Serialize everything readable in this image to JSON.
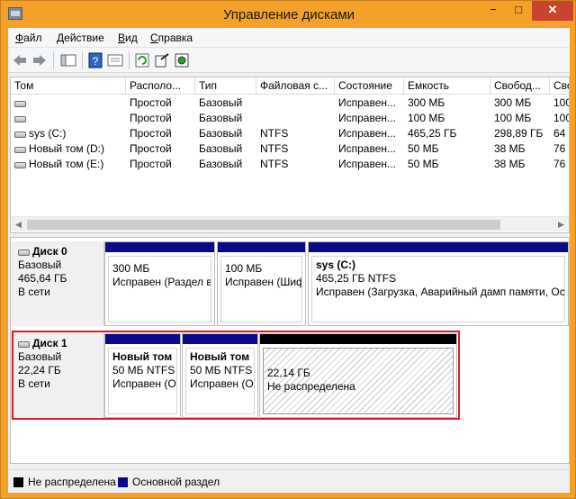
{
  "window": {
    "title": "Управление дисками",
    "min": "−",
    "max": "□",
    "close": "✕"
  },
  "menu": [
    {
      "hot": "Ф",
      "rest": "айл"
    },
    {
      "hot": "Д",
      "rest": "ействие"
    },
    {
      "hot": "В",
      "rest": "ид"
    },
    {
      "hot": "С",
      "rest": "правка"
    }
  ],
  "toolbar": {
    "icons": [
      "back-icon",
      "forward-icon",
      "show-hide-console-icon",
      "help-icon",
      "properties-icon",
      "refresh-icon",
      "export-icon",
      "settings-icon"
    ]
  },
  "list": {
    "columns": [
      "Том",
      "Располо...",
      "Тип",
      "Файловая с...",
      "Состояние",
      "Емкость",
      "Свобод...",
      "Сво"
    ],
    "rows": [
      [
        "",
        "Простой",
        "Базовый",
        "",
        "Исправен...",
        "300 МБ",
        "300 МБ",
        "100"
      ],
      [
        "",
        "Простой",
        "Базовый",
        "",
        "Исправен...",
        "100 МБ",
        "100 МБ",
        "100"
      ],
      [
        "sys (C:)",
        "Простой",
        "Базовый",
        "NTFS",
        "Исправен...",
        "465,25 ГБ",
        "298,89 ГБ",
        "64"
      ],
      [
        "Новый том (D:)",
        "Простой",
        "Базовый",
        "NTFS",
        "Исправен...",
        "50 МБ",
        "38 МБ",
        "76"
      ],
      [
        "Новый том (E:)",
        "Простой",
        "Базовый",
        "NTFS",
        "Исправен...",
        "50 МБ",
        "38 МБ",
        "76"
      ]
    ]
  },
  "disks": [
    {
      "name": "Диск 0",
      "type": "Базовый",
      "size": "465,64 ГБ",
      "status": "В сети",
      "partitions": [
        {
          "title": "",
          "line1": "300 МБ",
          "line2": "Исправен (Раздел во"
        },
        {
          "title": "",
          "line1": "100 МБ",
          "line2": "Исправен (Шиф"
        },
        {
          "title": "sys  (C:)",
          "line1": "465,25 ГБ NTFS",
          "line2": "Исправен (Загрузка, Аварийный дамп памяти, Ос"
        }
      ]
    },
    {
      "name": "Диск 1",
      "type": "Базовый",
      "size": "22,24 ГБ",
      "status": "В сети",
      "partitions": [
        {
          "title": "Новый том",
          "line1": "50 МБ NTFS",
          "line2": "Исправен (О"
        },
        {
          "title": "Новый том",
          "line1": "50 МБ NTFS",
          "line2": "Исправен (О"
        },
        {
          "title": "",
          "line1": "22,14 ГБ",
          "line2": "Не распределена"
        }
      ]
    }
  ],
  "legend": [
    {
      "label": "Не распределена",
      "color": "#000000"
    },
    {
      "label": "Основной раздел",
      "color": "#0a0a8a"
    }
  ]
}
